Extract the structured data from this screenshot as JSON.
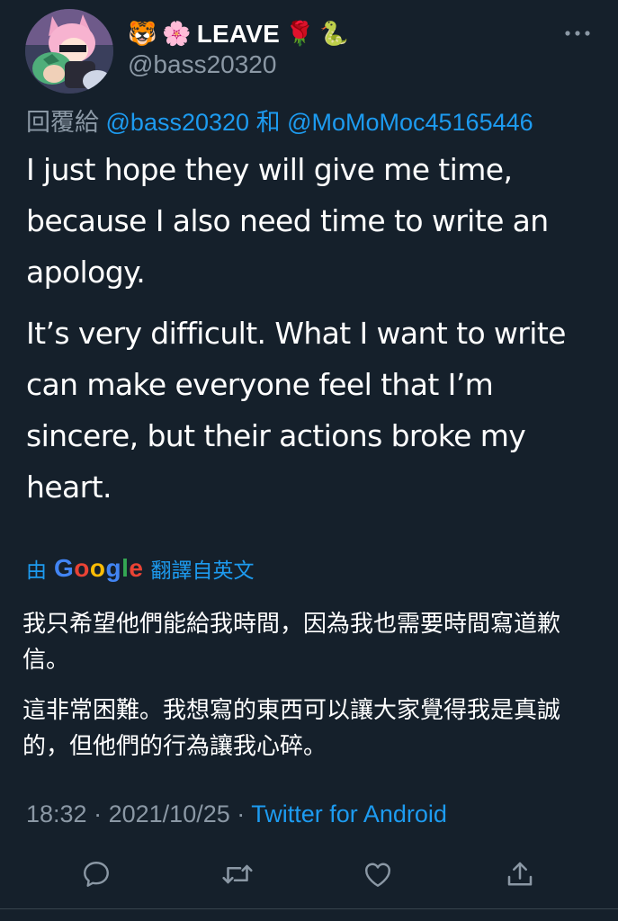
{
  "author": {
    "emoji_tiger": "🐯",
    "emoji_blossom": "🌸",
    "display_name": "LEAVE",
    "emoji_rose": "🌹",
    "emoji_snake": "🐍",
    "handle": "@bass20320"
  },
  "reply": {
    "prefix": "回覆給",
    "mention_1": "@bass20320",
    "conjunction": "和",
    "mention_2": "@MoMoMoc45165446"
  },
  "tweet": {
    "paragraph_1": "I just hope they will give me time, because I also need time to write an apology.",
    "paragraph_2": "It’s very difficult. What I want to write can make everyone feel that I’m sincere, but their actions broke my heart."
  },
  "translation": {
    "by_prefix": "由",
    "google": "Google",
    "by_suffix": "翻譯自英文",
    "paragraph_1": "我只希望他們能給我時間，因為我也需要時間寫道歉信。",
    "paragraph_2": "這非常困難。我想寫的東西可以讓大家覺得我是真誠的，但他們的行為讓我心碎。"
  },
  "meta": {
    "time": "18:32",
    "sep_1": "·",
    "date": "2021/10/25",
    "sep_2": "·",
    "source": "Twitter for Android"
  },
  "actions": {
    "icons": [
      "reply-icon",
      "retweet-icon",
      "like-icon",
      "share-icon"
    ]
  },
  "colors": {
    "background": "#15202b",
    "text": "#ffffff",
    "muted": "#8b98a5",
    "accent": "#1d9bf0",
    "google_blue": "#4285f4",
    "google_red": "#ea4335",
    "google_yellow": "#fbbc05",
    "google_green": "#34a853"
  }
}
